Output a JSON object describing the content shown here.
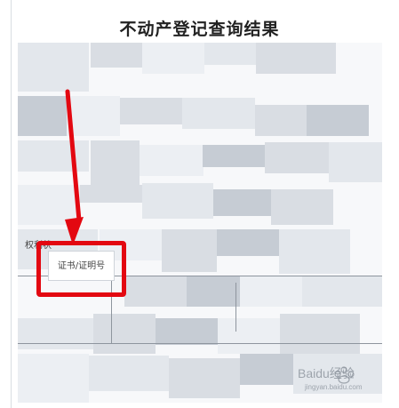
{
  "page": {
    "title": "不动产登记查询结果"
  },
  "document": {
    "blurred": true,
    "row_label": "权利状",
    "cert_field_text": "证书/证明号"
  },
  "annotation": {
    "arrow_color": "#e30811",
    "box_color": "#e30811"
  },
  "watermark": {
    "text": "Baidu经验",
    "sub_text": "jingyan.baidu.com"
  }
}
